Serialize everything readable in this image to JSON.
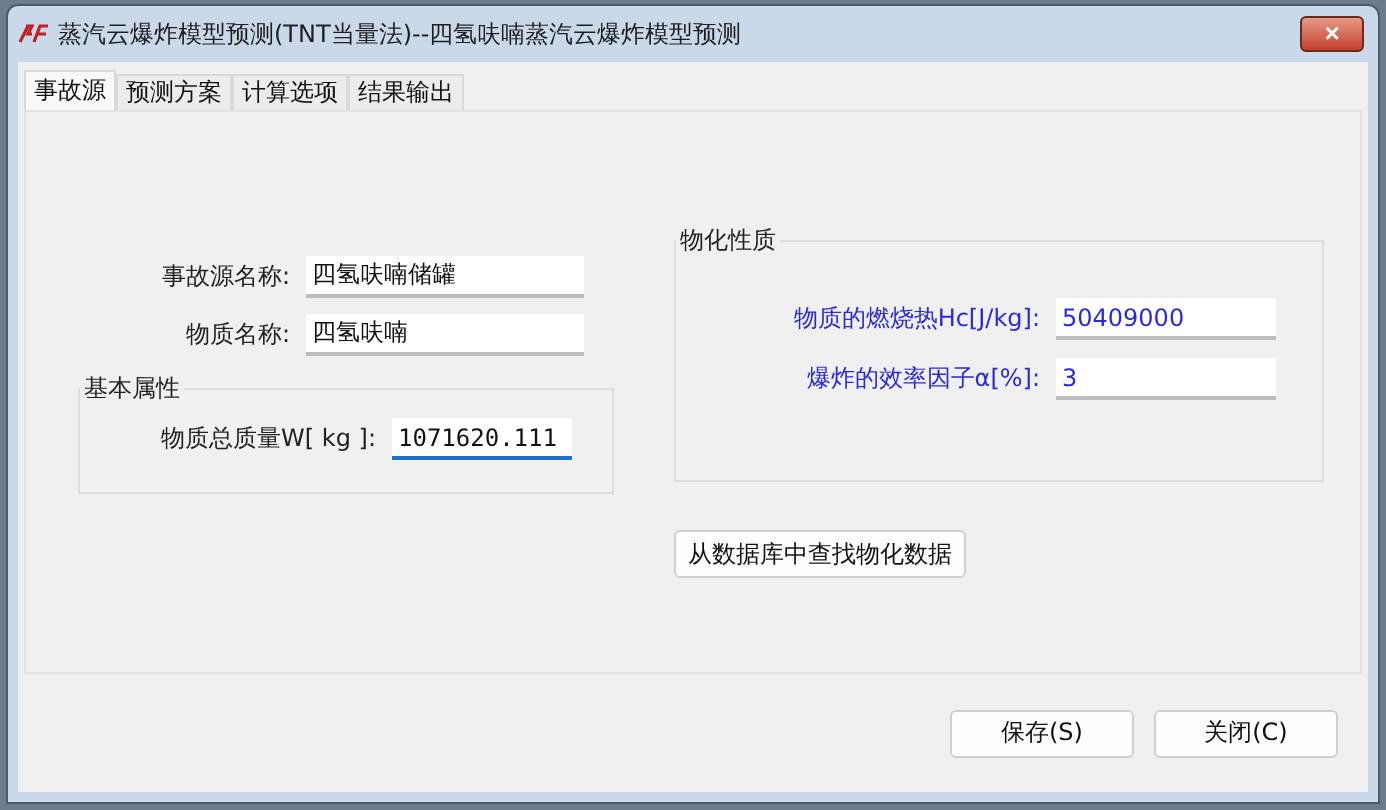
{
  "window": {
    "title": "蒸汽云爆炸模型预测(TNT当量法)--四氢呋喃蒸汽云爆炸模型预测",
    "close": "×"
  },
  "tabs": [
    {
      "label": "事故源",
      "selected": true
    },
    {
      "label": "预测方案",
      "selected": false
    },
    {
      "label": "计算选项",
      "selected": false
    },
    {
      "label": "结果输出",
      "selected": false
    }
  ],
  "source_fields": [
    {
      "label": "事故源名称:",
      "value": "四氢呋喃储罐",
      "focused": false
    },
    {
      "label": "物质名称:",
      "value": "四氢呋喃",
      "focused": false
    }
  ],
  "basic_group": {
    "title": "基本属性",
    "fields": [
      {
        "label": "物质总质量W[ kg ]:",
        "value": "1071620.111",
        "focused": true
      }
    ]
  },
  "physchem_group": {
    "title": "物化性质",
    "fields": [
      {
        "label": "物质的燃烧热Hc[J/kg]:",
        "value": "50409000",
        "focused": false
      },
      {
        "label": "爆炸的效率因子α[%]:",
        "value": "3",
        "focused": false
      }
    ]
  },
  "lookup_button": "从数据库中查找物化数据",
  "buttons": [
    "保存(S)",
    "关闭(C)"
  ]
}
